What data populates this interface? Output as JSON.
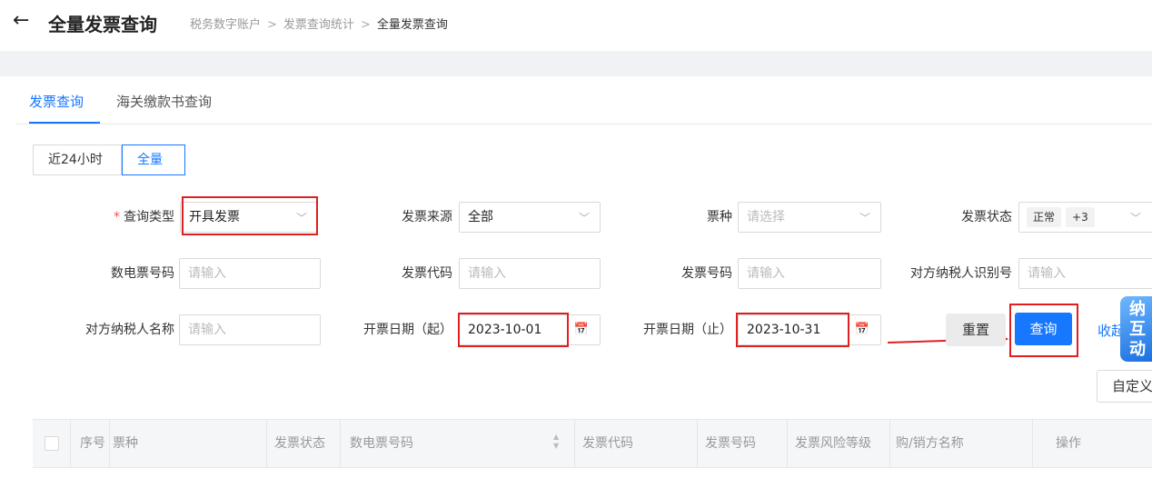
{
  "header": {
    "back_icon": "←",
    "title": "全量发票查询",
    "breadcrumb": [
      "税务数字账户",
      "发票查询统计",
      "全量发票查询"
    ],
    "breadcrumb_separator": ">"
  },
  "tabs": [
    {
      "label": "发票查询",
      "active": true
    },
    {
      "label": "海关缴款书查询",
      "active": false
    }
  ],
  "time_range": [
    {
      "label": "近24小时",
      "active": false
    },
    {
      "label": "全量",
      "active": true
    }
  ],
  "form": {
    "query_type": {
      "label": "查询类型",
      "value": "开具发票",
      "required": true
    },
    "invoice_source": {
      "label": "发票来源",
      "value": "全部"
    },
    "invoice_kind": {
      "label": "票种",
      "placeholder": "请选择"
    },
    "invoice_status": {
      "label": "发票状态",
      "tags": [
        "正常",
        "+3"
      ]
    },
    "e_invoice_no": {
      "label": "数电票号码",
      "placeholder": "请输入"
    },
    "invoice_code": {
      "label": "发票代码",
      "placeholder": "请输入"
    },
    "invoice_no": {
      "label": "发票号码",
      "placeholder": "请输入"
    },
    "counterparty_tax_id": {
      "label": "对方纳税人识别号",
      "placeholder": "请输入"
    },
    "counterparty_name": {
      "label": "对方纳税人名称",
      "placeholder": "请输入"
    },
    "date_start": {
      "label": "开票日期（起）",
      "value": "2023-10-01"
    },
    "date_end": {
      "label": "开票日期（止）",
      "value": "2023-10-31"
    }
  },
  "actions": {
    "reset": "重置",
    "query": "查询",
    "collapse": "收起",
    "custom": "自定义"
  },
  "badge": {
    "lines": [
      "纳",
      "互",
      "动"
    ]
  },
  "table": {
    "columns": [
      "序号",
      "票种",
      "发票状态",
      "数电票号码",
      "发票代码",
      "发票号码",
      "发票风险等级",
      "购/销方名称",
      "操作"
    ]
  },
  "annotation_color": "#e02020",
  "accent_color": "#1677ff"
}
